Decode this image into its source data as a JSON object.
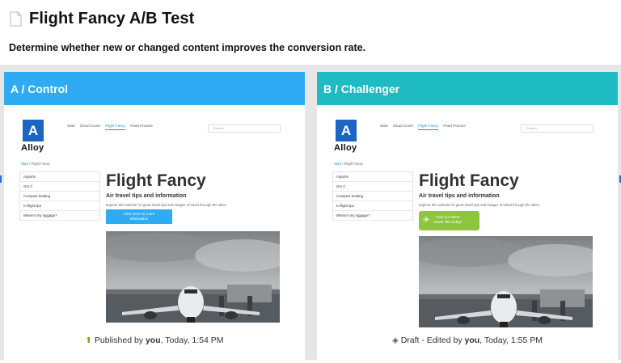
{
  "page": {
    "title": "Flight Fancy A/B Test",
    "description": "Determine whether new or changed content improves the conversion rate."
  },
  "panels": {
    "a": {
      "header": "A / Control",
      "status_prefix": "Published by",
      "status_user": "you",
      "status_time": ", Today, 1:54 PM",
      "cta_line1": "Click here for more",
      "cta_line2": "information"
    },
    "b": {
      "header": "B / Challenger",
      "status_prefix": "Draft - Edited by",
      "status_user": "you",
      "status_time": ", Today, 1:55 PM",
      "cta_line1": "Visit our NEW",
      "cta_line2": "travel site today!"
    }
  },
  "site": {
    "logo_letter": "A",
    "logo_word": "Alloy",
    "nav": [
      "Start",
      "Cloud Cover",
      "Flight Fancy",
      "Pearl Pounce"
    ],
    "search_placeholder": "Search",
    "breadcrumb_home": "Start",
    "breadcrumb_sep": " / ",
    "breadcrumb_current": "Flight Fancy",
    "menu": [
      "Airports",
      "Gru C",
      "Compact Seating",
      "In-flight tips",
      "Where's my luggage?"
    ],
    "hero_title": "Flight Fancy",
    "hero_subtitle": "Air travel tips and information",
    "hero_desc": "Explore this website for great travel tips and images of travel through the skies."
  },
  "icons": {
    "page": "document-icon",
    "published": "arrow-up-icon",
    "draft": "layers-icon",
    "cta_b": "plane-icon"
  },
  "colors": {
    "control_header": "#2eabf2",
    "challenger_header": "#1ebbc2",
    "cta_blue": "#2eabf2",
    "cta_green": "#8cc63f",
    "logo_blue": "#1a66c2"
  }
}
